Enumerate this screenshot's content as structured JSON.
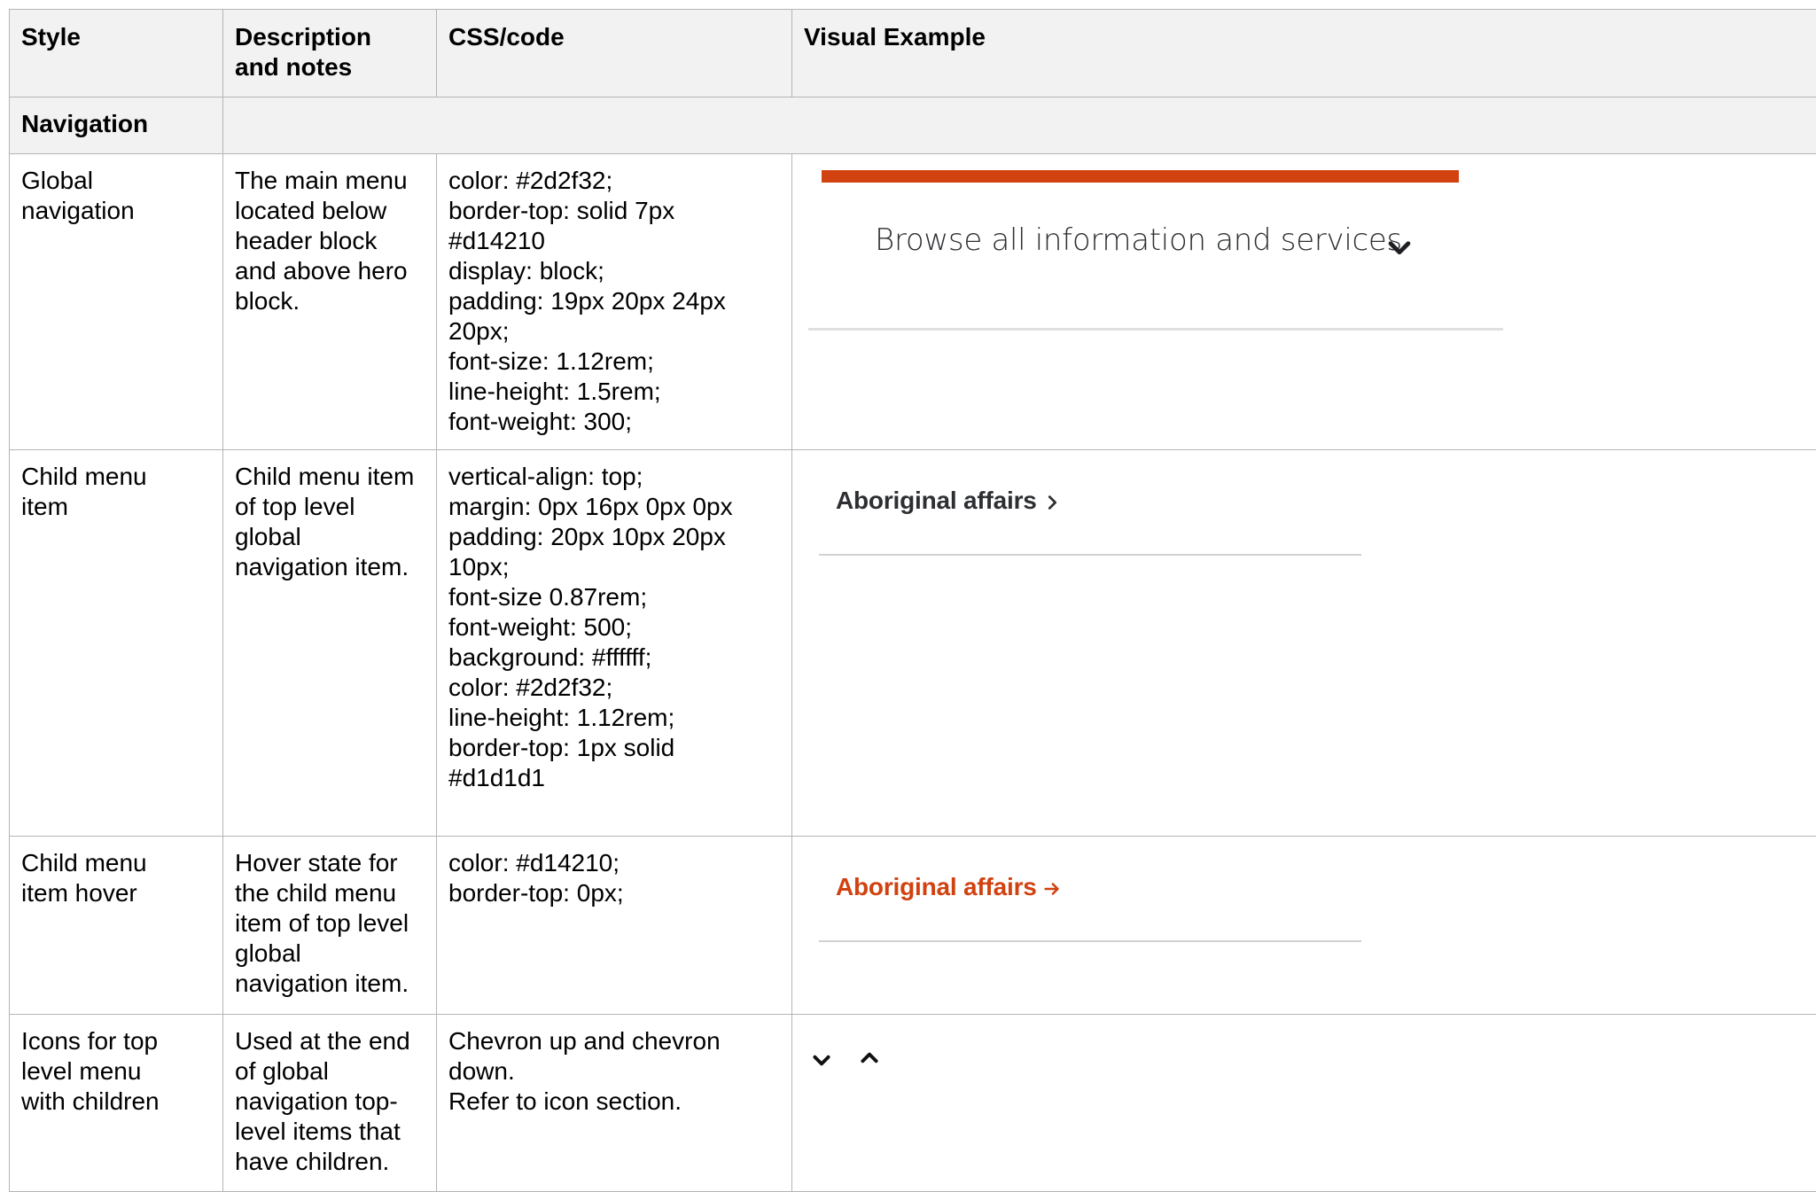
{
  "table": {
    "headers": [
      "Style",
      "Description\nand notes",
      "CSS/code",
      "Visual Example"
    ],
    "section_title": "Navigation",
    "rows": [
      {
        "style": "Global\nnavigation",
        "description": "The main menu\nlocated below\nheader block\nand above hero\nblock.",
        "css": "color: #2d2f32;\nborder-top: solid 7px\n#d14210\ndisplay: block;\npadding: 19px 20px 24px\n20px;\nfont-size: 1.12rem;\nline-height: 1.5rem;\nfont-weight: 300;",
        "visual_label": "Browse all information and services",
        "visual_icon": "chevron-down-icon"
      },
      {
        "style": "Child menu\nitem",
        "description": "Child menu item\nof top level\nglobal\nnavigation item.",
        "css": "vertical-align: top;\nmargin: 0px 16px 0px 0px\npadding: 20px 10px 20px\n10px;\nfont-size 0.87rem;\nfont-weight: 500;\nbackground: #ffffff;\ncolor: #2d2f32;\nline-height: 1.12rem;\nborder-top: 1px solid\n#d1d1d1",
        "visual_label": "Aboriginal affairs",
        "visual_icon": "chevron-right-icon"
      },
      {
        "style": "Child menu\nitem hover",
        "description": "Hover state for\nthe child menu\nitem of top level\nglobal\nnavigation item.",
        "css": "color: #d14210;\nborder-top: 0px;",
        "visual_label": "Aboriginal affairs",
        "visual_icon": "arrow-right-icon"
      },
      {
        "style": "Icons for top\nlevel menu\nwith children",
        "description": "Used at the end\nof global\nnavigation top-\nlevel items that\nhave children.",
        "css": "Chevron up and chevron\ndown.\nRefer to icon section.",
        "visual_icons": [
          "chevron-down-icon",
          "chevron-up-icon"
        ]
      }
    ]
  },
  "colors": {
    "accent": "#d14210",
    "text": "#2d2f32",
    "divider": "#d1d1d1",
    "header_bg": "#f2f2f2",
    "border": "#b5b5b5"
  }
}
